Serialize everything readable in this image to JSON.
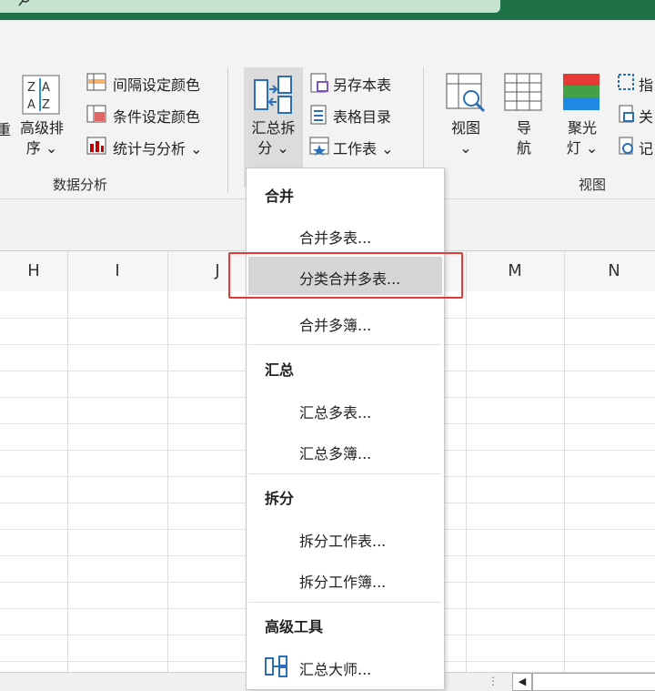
{
  "ribbon": {
    "left_partial_label": "重",
    "sort": {
      "line1": "高级排",
      "line2": "序 ⌄"
    },
    "analysis_items": [
      "间隔设定颜色",
      "条件设定颜色",
      "统计与分析 ⌄"
    ],
    "analysis_group": "数据分析",
    "summary_split": {
      "line1": "汇总拆",
      "line2": "分 ⌄"
    },
    "file_items": [
      "另存本表",
      "表格目录",
      "工作表 ⌄"
    ],
    "view": {
      "line1": "视图",
      "line2": "⌄"
    },
    "nav": {
      "line1": "导",
      "line2": "航"
    },
    "spotlight": {
      "line1": "聚光",
      "line2": "灯 ⌄"
    },
    "right_items": [
      "指",
      "关",
      "记"
    ],
    "view_group": "视图"
  },
  "columns": [
    "H",
    "I",
    "J",
    "M",
    "N"
  ],
  "menu": {
    "sections": [
      {
        "title": "合并",
        "items": [
          "合并多表...",
          "分类合并多表...",
          "合并多簿..."
        ]
      },
      {
        "title": "汇总",
        "items": [
          "汇总多表...",
          "汇总多簿..."
        ]
      },
      {
        "title": "拆分",
        "items": [
          "拆分工作表...",
          "拆分工作簿..."
        ]
      },
      {
        "title": "高级工具",
        "items": [
          "汇总大师..."
        ]
      }
    ],
    "highlighted": "分类合并多表..."
  },
  "colors": {
    "titlebar": "#1e7145",
    "highlight": "#d5d5d5",
    "redbox": "#e53935"
  }
}
